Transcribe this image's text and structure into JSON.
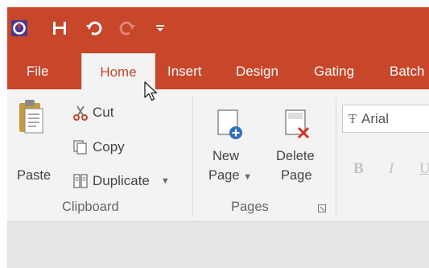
{
  "quick_access": {
    "icons": [
      "app-icon",
      "save-icon",
      "undo-icon",
      "redo-icon",
      "customize-qat-icon"
    ]
  },
  "tabs": [
    {
      "label": "File",
      "active": false
    },
    {
      "label": "Home",
      "active": true
    },
    {
      "label": "Insert",
      "active": false
    },
    {
      "label": "Design",
      "active": false
    },
    {
      "label": "Gating",
      "active": false
    },
    {
      "label": "Batch",
      "active": false
    }
  ],
  "clipboard": {
    "paste_label": "Paste",
    "cut_label": "Cut",
    "copy_label": "Copy",
    "duplicate_label": "Duplicate",
    "group_label": "Clipboard"
  },
  "pages": {
    "new_line1": "New",
    "new_line2": "Page",
    "delete_line1": "Delete",
    "delete_line2": "Page",
    "group_label": "Pages"
  },
  "font": {
    "font_name": "Arial",
    "bold_label": "B",
    "italic_label": "I",
    "underline_label": "U"
  },
  "colors": {
    "accent": "#c8462a",
    "ribbon_bg": "#f3f3f3",
    "tab_text": "#ffffff"
  }
}
